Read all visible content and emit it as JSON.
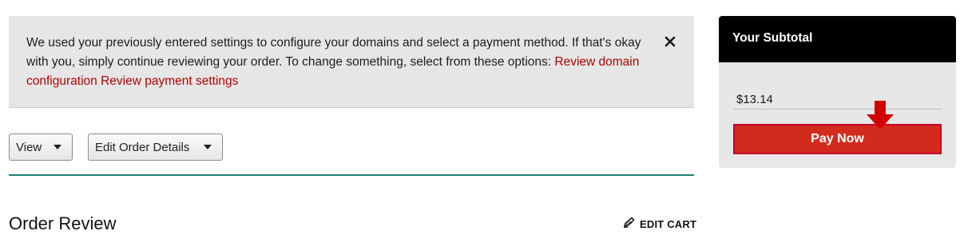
{
  "notice": {
    "text": "We used your previously entered settings to configure your domains and select a payment method. If that's okay with you, simply continue reviewing your order. To change something, select from these options: ",
    "link1": "Review domain configuration",
    "link2": "Review payment settings",
    "close_icon": "close-icon"
  },
  "toolbar": {
    "view_label": "View",
    "edit_order_label": "Edit Order Details"
  },
  "order": {
    "title": "Order Review",
    "edit_cart_label": "EDIT CART",
    "edit_cart_icon": "pencil-icon"
  },
  "subtotal": {
    "title": "Your Subtotal",
    "amount": "$13.14",
    "pay_label": "Pay Now"
  },
  "colors": {
    "link": "#b30000",
    "accent_rule": "#1f7f7c",
    "pay_button": "#d22b1d",
    "annotation_arrow": "#d20000"
  }
}
